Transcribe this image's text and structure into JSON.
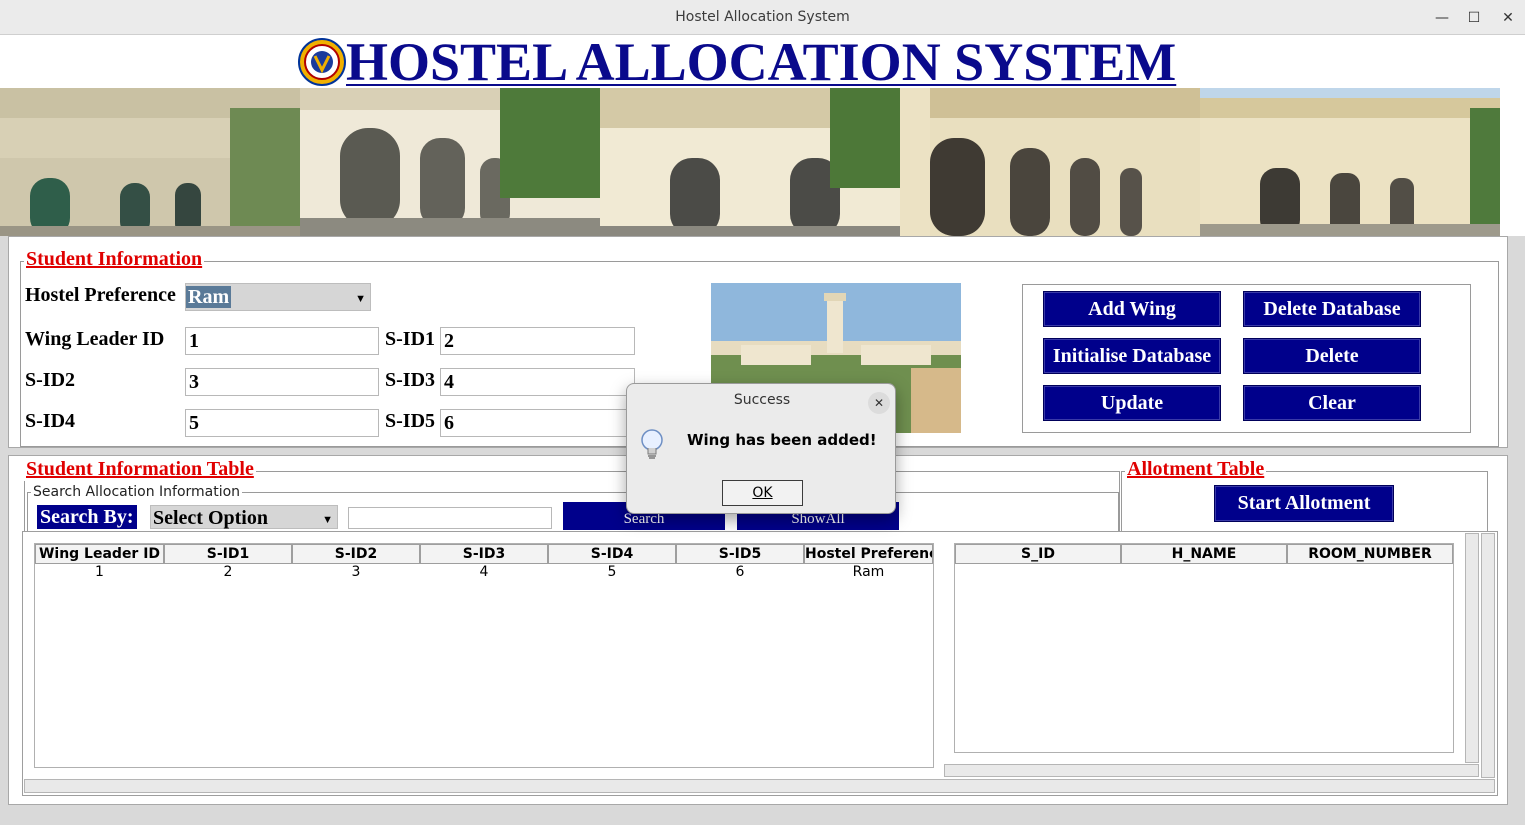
{
  "window": {
    "title": "Hostel Allocation System",
    "minimize_glyph": "—",
    "maximize_glyph": "☐",
    "close_glyph": "✕"
  },
  "header": {
    "heading": "HOSTEL ALLOCATION SYSTEM",
    "logo_icon": "institute-emblem-icon",
    "heading_color": "#0a0a8c"
  },
  "banner": {
    "photo_count": 5
  },
  "student_info": {
    "legend": "Student Information",
    "hostel_pref_label": "Hostel Preference",
    "hostel_pref_value": "Ram",
    "wing_leader_label": "Wing Leader ID",
    "wing_leader_value": "1",
    "sid1_label": "S-ID1",
    "sid1_value": "2",
    "sid2_label": "S-ID2",
    "sid2_value": "3",
    "sid3_label": "S-ID3",
    "sid3_value": "4",
    "sid4_label": "S-ID4",
    "sid4_value": "5",
    "sid5_label": "S-ID5",
    "sid5_value": "6"
  },
  "actions": {
    "add_wing": "Add Wing",
    "delete_database": "Delete Database",
    "initialise_database": "Initialise Database",
    "delete": "Delete",
    "update": "Update",
    "clear": "Clear",
    "button_color": "#00008b"
  },
  "student_table": {
    "legend": "Student Information Table",
    "search_group": "Search Allocation Information",
    "search_by_label": "Search By:",
    "search_option": "Select Option",
    "search_value": "",
    "search_button": "Search",
    "showall_button": "ShowAll",
    "columns": [
      "Wing Leader ID",
      "S-ID1",
      "S-ID2",
      "S-ID3",
      "S-ID4",
      "S-ID5",
      "Hostel Preferenc"
    ],
    "rows": [
      [
        "1",
        "2",
        "3",
        "4",
        "5",
        "6",
        "Ram"
      ]
    ]
  },
  "allotment": {
    "legend": "Allotment Table",
    "start_button": "Start Allotment",
    "columns": [
      "S_ID",
      "H_NAME",
      "ROOM_NUMBER"
    ]
  },
  "dialog": {
    "title": "Success",
    "message": "Wing has been added!",
    "ok_label": "OK",
    "icon": "lightbulb-info-icon",
    "close_glyph": "✕"
  },
  "colors": {
    "legend_red": "#e00000",
    "button_navy": "#00008b"
  }
}
